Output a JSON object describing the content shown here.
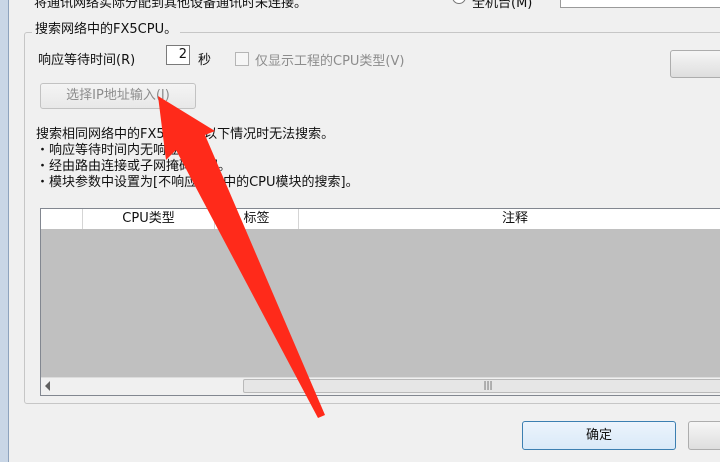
{
  "dialog": {
    "top_partial_text": "将通讯网络实际分配到其他设备通讯时未连接。",
    "top_radio_label": "全机台(M)",
    "group_title": "搜索网络中的FX5CPU。",
    "response_label": "响应等待时间(R)",
    "response_value": "2",
    "response_unit": "秒",
    "show_project_cpu_label": "仅显示工程的CPU类型(V)",
    "ip_button_label": "选择IP地址输入(I)",
    "description_lines": [
      "搜索相同网络中的FX5CPU。以下情况时无法搜索。",
      "・响应等待时间内无响应。",
      "・经由路由连接或子网掩码不同。",
      "・模块参数中设置为[不响应网络中的CPU模块的搜索]。"
    ],
    "table": {
      "columns": [
        "",
        "CPU类型",
        "标签",
        "注释"
      ]
    },
    "scroll_thumb_glyph": "|||",
    "ok_button_label": "确定",
    "cancel_button_label": ""
  },
  "annotation": {
    "arrow_color": "#ff2a1a",
    "icon": "red-arrow-icon"
  }
}
